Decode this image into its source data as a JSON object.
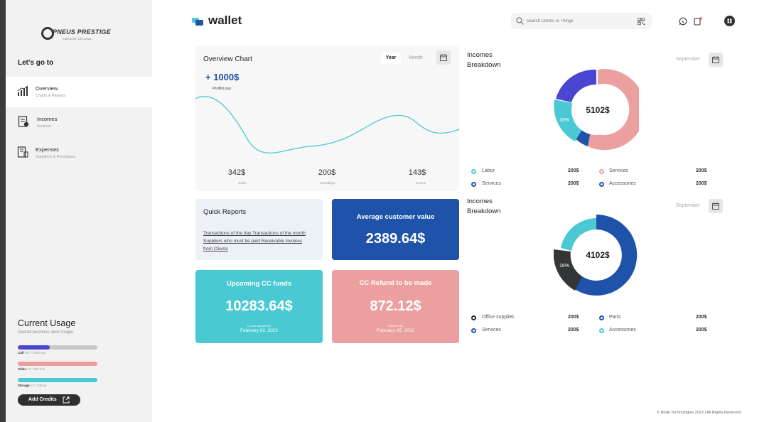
{
  "colors": {
    "primary_blue": "#1e53a9",
    "cyan": "#4bc9d3",
    "pink": "#eb9f9e",
    "indigo": "#4a46d1",
    "dark": "#2f2f2f",
    "sidebar_bg": "#f2f2f3"
  },
  "sidebar": {
    "logo_text": "PNEUS PRESTIGE",
    "logo_sub": "GARAGE LELAVAL",
    "section_title": "Let's go to",
    "items": [
      {
        "label": "Overview",
        "sub": "Charts & Reports",
        "icon": "bar-chart-icon",
        "active": true
      },
      {
        "label": "Incomes",
        "sub": "Invoices",
        "icon": "invoice-icon",
        "active": false
      },
      {
        "label": "Expenses",
        "sub": "Suppliers & Purchases",
        "icon": "expenses-icon",
        "active": false
      }
    ],
    "usage": {
      "title": "Current Usage",
      "subtitle": "Overall business desk Usage",
      "bars": [
        {
          "name": "Call",
          "value": "257 / 1000 min",
          "fraction": 0.4,
          "color": "#4a46d1"
        },
        {
          "name": "Video",
          "value": "72 / 100 min",
          "fraction": 1.0,
          "color": "#eb9f9e"
        },
        {
          "name": "Storage",
          "value": "12 / 100 go",
          "fraction": 1.0,
          "color": "#4bc9d3"
        }
      ]
    },
    "add_credits_label": "Add Credits"
  },
  "header": {
    "brand": "wallet",
    "search_placeholder": "Search Clients or Things",
    "icons": [
      "whatsapp-icon",
      "notification-icon",
      "user-avatar"
    ]
  },
  "overview": {
    "title": "Overview Chart",
    "tab_year": "Year",
    "tab_month": "Month",
    "profit_value": "+ 1000$",
    "profit_label": "Profit/Loss",
    "stats": [
      {
        "value": "342$",
        "label": "Sales"
      },
      {
        "value": "200$",
        "label": "Spendings"
      },
      {
        "value": "143$",
        "label": "Income"
      }
    ]
  },
  "quick_reports": {
    "title": "Quick Reports",
    "text": "Transactions of the day Transactions of the month Suppliers who must be paid Receivable invoices from Clients"
  },
  "average": {
    "title": "Average customer value",
    "value": "2389.64$"
  },
  "upcoming": {
    "title": "Upcoming CC funds",
    "value": "10283.64$",
    "sub": "In your account by",
    "date": "February 02, 2022"
  },
  "refund": {
    "title": "CC Refund to be made",
    "value": "872.12$",
    "sub": "Payment by",
    "date": "February 05, 2022"
  },
  "breakdown1": {
    "title_line1": "Incomes",
    "title_line2": "Breakdown",
    "month": "September",
    "center": "5102$",
    "slice_label": "16%",
    "legend": [
      {
        "label": "Labor",
        "value": "200$",
        "color": "#4bc9d3"
      },
      {
        "label": "Services",
        "value": "200$",
        "color": "#eb9f9e"
      },
      {
        "label": "Services",
        "value": "200$",
        "color": "#1e53a9"
      },
      {
        "label": "Accessories",
        "value": "200$",
        "color": "#1e53a9"
      }
    ]
  },
  "breakdown2": {
    "title_line1": "Incomes",
    "title_line2": "Breakdown",
    "month": "September",
    "center": "4102$",
    "slice_label": "16%",
    "legend": [
      {
        "label": "Office supplies",
        "value": "200$",
        "color": "#2f2f2f"
      },
      {
        "label": "Parts",
        "value": "200$",
        "color": "#1e53a9"
      },
      {
        "label": "Services",
        "value": "200$",
        "color": "#1e53a9"
      },
      {
        "label": "Accessories",
        "value": "200$",
        "color": "#4bc9d3"
      }
    ]
  },
  "footer": "© Node Technologies 2022 | All Rights Reserved"
}
